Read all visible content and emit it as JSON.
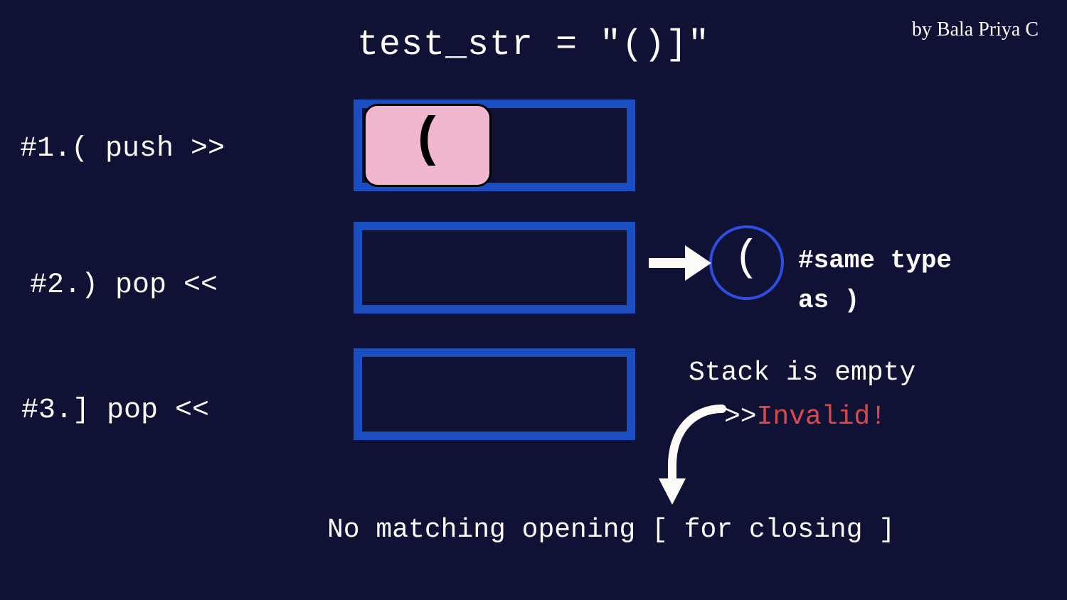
{
  "title": "test_str = \"()]\"",
  "author": "by Bala Priya C",
  "steps": {
    "s1_label": "#1.( push >>",
    "s2_label": "#2.) pop <<",
    "s3_label": "#3.] pop <<"
  },
  "push_tile_char": "(",
  "pop_circle_char": "(",
  "same_type_text": "#same type\nas )",
  "stack_empty_text": "Stack is empty",
  "invalid_prefix": ">>",
  "invalid_word": "Invalid!",
  "no_match_text": "No matching opening [ for closing ]"
}
